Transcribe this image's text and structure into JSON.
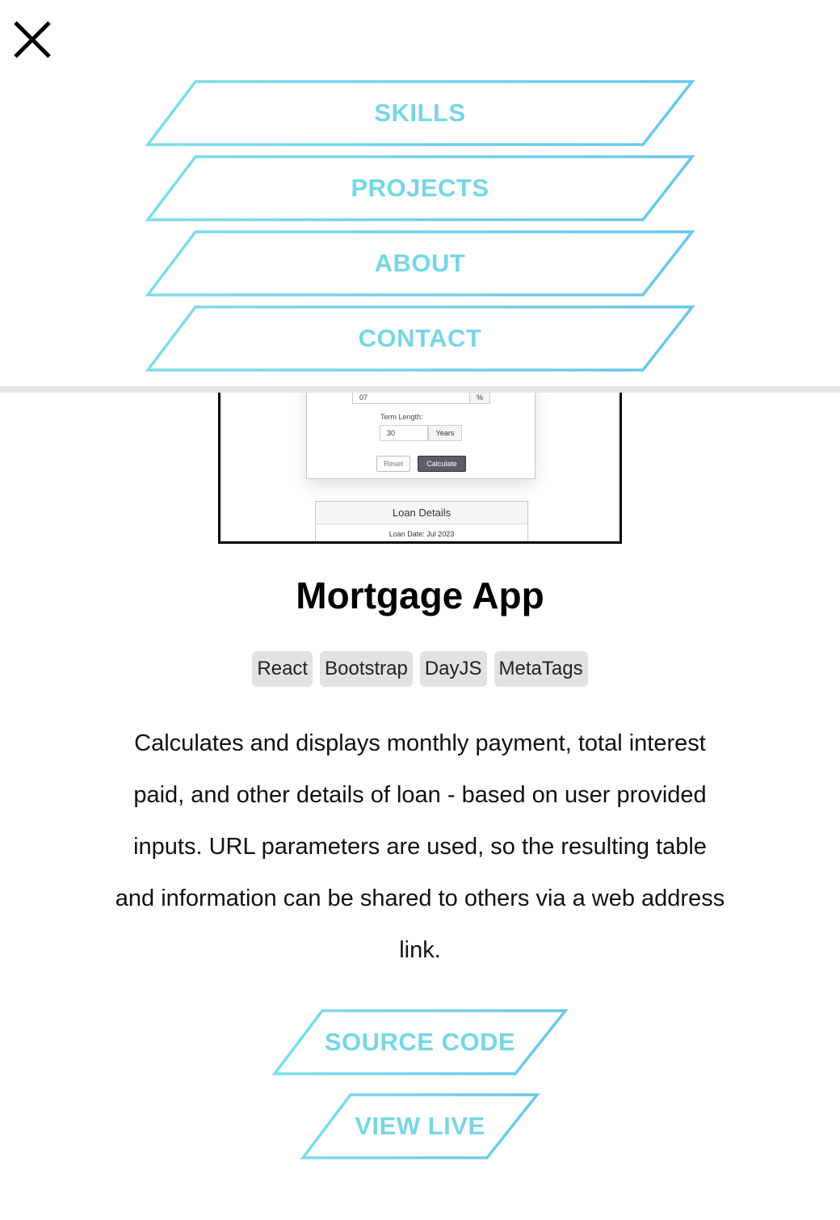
{
  "nav": {
    "items": [
      {
        "label": "SKILLS"
      },
      {
        "label": "PROJECTS"
      },
      {
        "label": "ABOUT"
      },
      {
        "label": "CONTACT"
      }
    ]
  },
  "preview": {
    "rate_value": "07",
    "rate_unit": "%",
    "term_label": "Term Length:",
    "term_value": "30",
    "term_unit": "Years",
    "reset_label": "Reset",
    "calculate_label": "Calculate",
    "loan_details_heading": "Loan Details",
    "loan_date": "Loan Date: Jul 2023"
  },
  "project": {
    "title": "Mortgage App",
    "tags": [
      "React",
      "Bootstrap",
      "DayJS",
      "MetaTags"
    ],
    "description": "Calculates and displays monthly payment, total interest paid, and other details of loan - based on user provided inputs. URL parameters are used, so the resulting table and information can be shared to others via a web address link.",
    "source_code_label": "SOURCE CODE",
    "view_live_label": "VIEW LIVE"
  },
  "colors": {
    "accent_start": "#7cdde8",
    "accent_end": "#69c7e9",
    "tag_bg": "#e2e2e2"
  },
  "icons": {
    "close": "close-icon"
  }
}
